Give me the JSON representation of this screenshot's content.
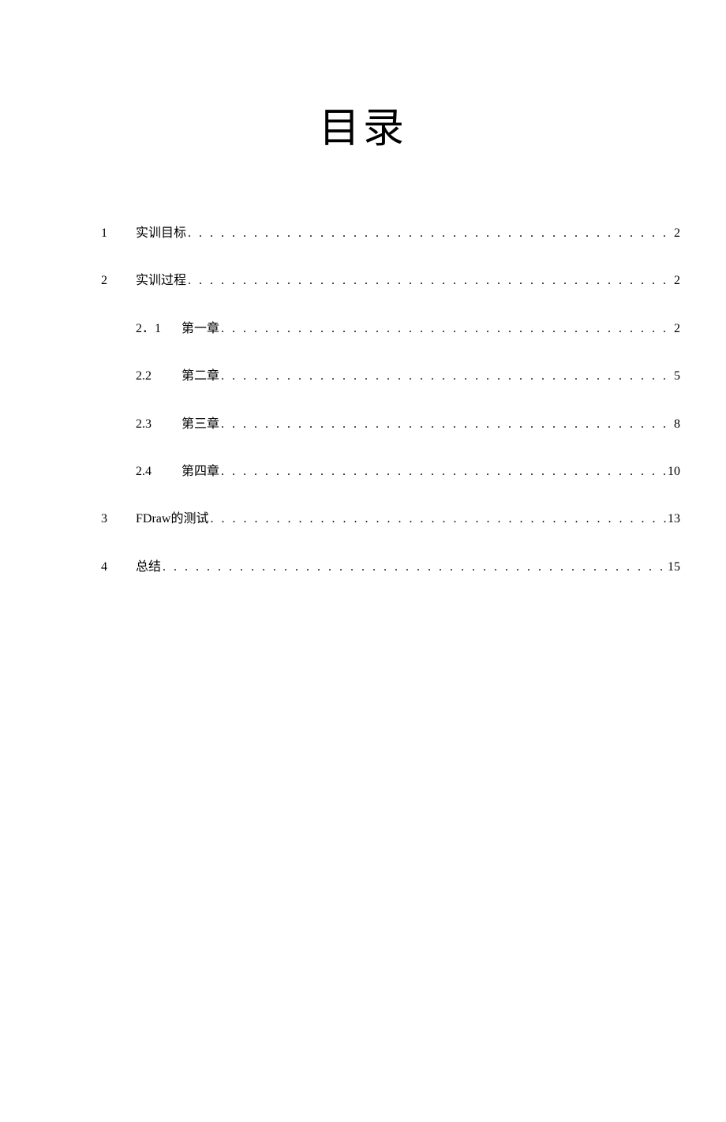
{
  "title": "目录",
  "entries": [
    {
      "level": 1,
      "number": "1",
      "label": "实训目标",
      "page": "2"
    },
    {
      "level": 1,
      "number": "2",
      "label": "实训过程",
      "page": "2"
    },
    {
      "level": 2,
      "number": "2．1",
      "label": "第一章",
      "page": "2"
    },
    {
      "level": 2,
      "number": "2.2",
      "label": "第二章",
      "page": "5"
    },
    {
      "level": 2,
      "number": "2.3",
      "label": "第三章",
      "page": "8"
    },
    {
      "level": 2,
      "number": "2.4",
      "label": "第四章",
      "page": "10"
    },
    {
      "level": 1,
      "number": "3",
      "label": "FDraw的测试",
      "page": "13"
    },
    {
      "level": 1,
      "number": "4",
      "label": "总结",
      "page": "15"
    }
  ]
}
